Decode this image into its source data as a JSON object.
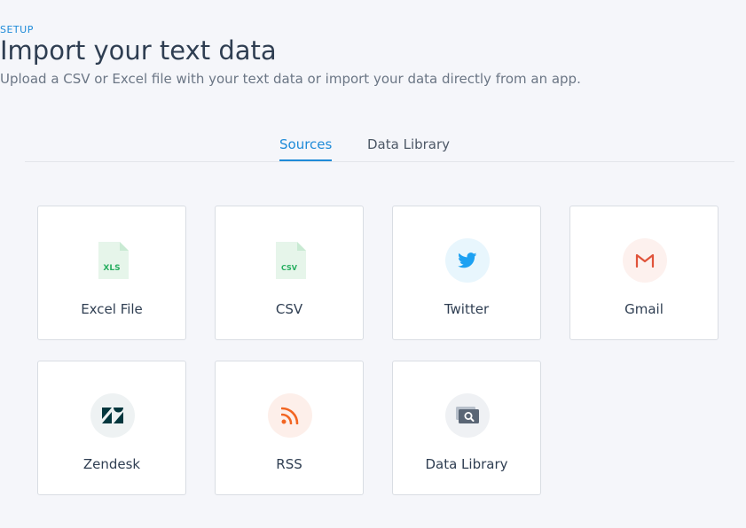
{
  "header": {
    "eyebrow": "SETUP",
    "title": "Import your text data",
    "subtitle": "Upload a CSV or Excel file with your text data or import your data directly from an app."
  },
  "tabs": [
    {
      "label": "Sources",
      "active": true
    },
    {
      "label": "Data Library",
      "active": false
    }
  ],
  "sources": [
    {
      "label": "Excel File",
      "icon": "xls-file-icon",
      "icon_text": "XLS",
      "color": "#27ae60"
    },
    {
      "label": "CSV",
      "icon": "csv-file-icon",
      "icon_text": "CSV",
      "color": "#27ae60"
    },
    {
      "label": "Twitter",
      "icon": "twitter-icon",
      "color": "#1da1f2"
    },
    {
      "label": "Gmail",
      "icon": "gmail-icon",
      "color": "#e0533a"
    },
    {
      "label": "Zendesk",
      "icon": "zendesk-icon",
      "color": "#03363d"
    },
    {
      "label": "RSS",
      "icon": "rss-icon",
      "color": "#f26522"
    },
    {
      "label": "Data Library",
      "icon": "data-library-icon",
      "color": "#6b7685"
    }
  ],
  "colors": {
    "accent": "#1f8bd8",
    "background": "#f5f6fa"
  }
}
